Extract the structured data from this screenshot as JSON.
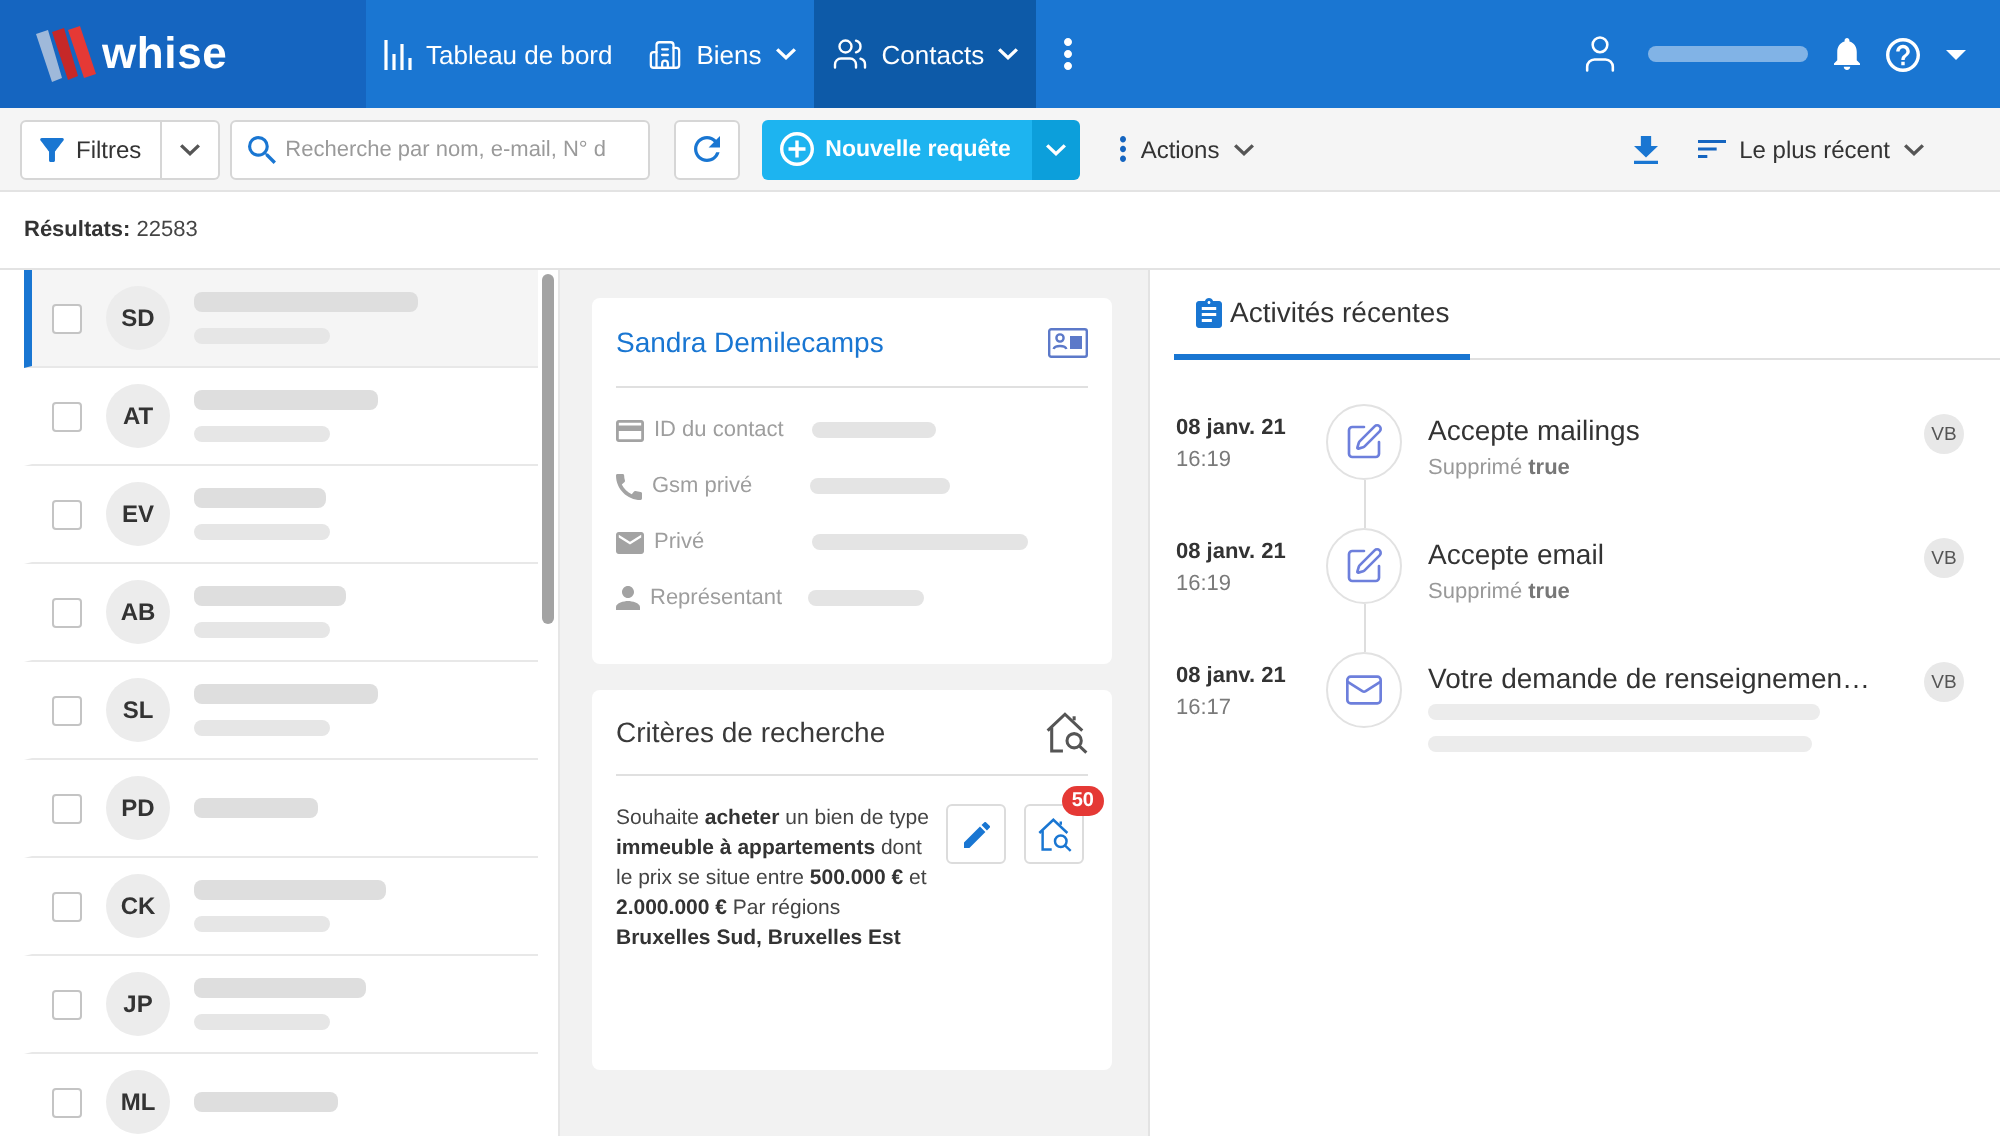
{
  "header": {
    "logo": "whise",
    "nav": [
      {
        "label": "Tableau de bord",
        "selected": false,
        "dropdown": false
      },
      {
        "label": "Biens",
        "selected": false,
        "dropdown": true
      },
      {
        "label": "Contacts",
        "selected": true,
        "dropdown": true
      }
    ]
  },
  "toolbar": {
    "filter_button": "Filtres",
    "search": {
      "placeholder": "Recherche par nom, e-mail, N° d"
    },
    "new_button": "Nouvelle requête",
    "actions_button": "Actions",
    "sort_button": "Le plus récent"
  },
  "results": "**Résultats:** 22583",
  "contacts": [
    {
      "initials": "SD",
      "selected": true,
      "checked": false,
      "phone_shown": true
    },
    {
      "initials": "AT",
      "selected": false,
      "checked": false,
      "phone_shown": true
    },
    {
      "initials": "EV",
      "selected": false,
      "checked": false,
      "phone_shown": true
    },
    {
      "initials": "AB",
      "selected": false,
      "checked": false,
      "phone_shown": true
    },
    {
      "initials": "SL",
      "selected": false,
      "checked": false,
      "phone_shown": true
    },
    {
      "initials": "PD",
      "selected": false,
      "checked": false,
      "phone_shown": false
    },
    {
      "initials": "CK",
      "selected": false,
      "checked": false,
      "phone_shown": true
    },
    {
      "initials": "JP",
      "selected": false,
      "checked": false,
      "phone_shown": true
    },
    {
      "initials": "ML",
      "selected": false,
      "checked": false,
      "phone_shown": false
    }
  ],
  "contact_card": {
    "name": "Sandra Demilecamps",
    "fields": [
      {
        "label": "ID du contact"
      },
      {
        "label": "Gsm privé"
      },
      {
        "label": "Privé"
      },
      {
        "label": "Représentant"
      }
    ]
  },
  "criteria_card": {
    "title": "Critères de recherche",
    "description": "Souhaite **acheter** un bien de type **immeuble à appartements** dont le prix se situe entre **500.000 €** et **2.000.000 €** Par régions **Bruxelles Sud, Bruxelles Est**",
    "match_count": "50"
  },
  "activities": {
    "tab": "Activités récentes",
    "items": [
      {
        "kind": "edit",
        "date": "08 janv. 21",
        "time": "16:19",
        "title": "Accepte mailings",
        "detail": "Supprimé **true**",
        "preview_shown": false,
        "user": "VB"
      },
      {
        "kind": "edit",
        "date": "08 janv. 21",
        "time": "16:19",
        "title": "Accepte email",
        "detail": "Supprimé **true**",
        "preview_shown": false,
        "user": "VB"
      },
      {
        "kind": "email",
        "date": "08 janv. 21",
        "time": "16:17",
        "title": "Votre demande de renseignemen…",
        "preview_shown": true,
        "user": "VB"
      }
    ]
  }
}
